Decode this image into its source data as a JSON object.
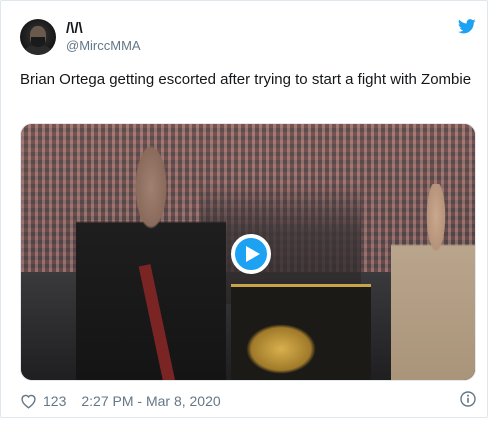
{
  "tweet": {
    "display_name": "/\\/\\",
    "handle": "@MirccMMA",
    "text": "Brian Ortega getting escorted after trying to start a fight with Zombie",
    "likes": "123",
    "timestamp": "2:27 PM - Mar 8, 2020"
  },
  "icons": {
    "brand": "twitter-bird-icon",
    "play": "play-icon",
    "like": "heart-icon",
    "info": "info-icon"
  },
  "colors": {
    "brand_blue": "#1da1f2",
    "text_primary": "#14171a",
    "text_secondary": "#657786",
    "border": "#e1e8ed"
  }
}
